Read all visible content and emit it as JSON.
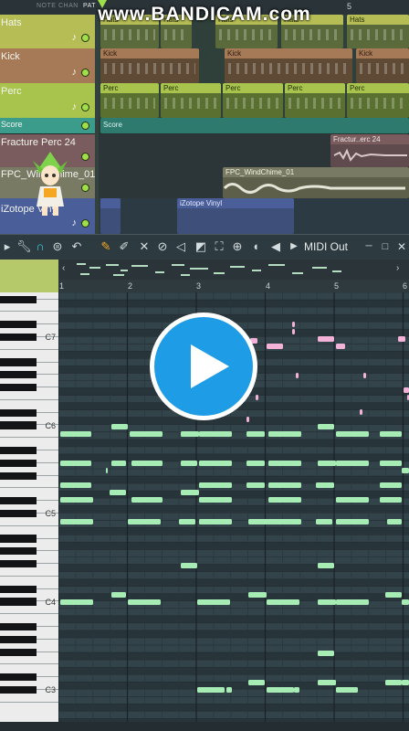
{
  "watermark": "www.BANDICAM.com",
  "header": {
    "labels": [
      "NOTE",
      "CHAN",
      "PAT"
    ],
    "bar_5": "5"
  },
  "tracks": [
    {
      "name": "Hats",
      "color": "#b5bd54"
    },
    {
      "name": "Kick",
      "color": "#a67a57"
    },
    {
      "name": "Perc",
      "color": "#a8c44c"
    },
    {
      "name": "Score",
      "color": "#3c9c8c"
    },
    {
      "name": "Fracture Perc 24",
      "color": "#7a5c5f"
    },
    {
      "name": "FPC_WindChime_01",
      "color": "#787a63"
    },
    {
      "name": "iZotope Vinyl",
      "color": "#4a5f9a"
    }
  ],
  "clips": {
    "hats": "Hats",
    "kick": "Kick",
    "perc": "Perc",
    "score": "Score",
    "fracture": "Fractur..erc 24",
    "windchime": "FPC_WindChime_01",
    "vinyl": "iZotope Vinyl"
  },
  "toolbar": {
    "midi_out": "MIDI Out",
    "icons": [
      "play-arrow-icon",
      "wrench-icon",
      "magnet-icon",
      "menu-icon",
      "undo-icon",
      "pencil-icon",
      "brush-icon",
      "delete-icon",
      "mute-icon",
      "slice-icon",
      "select-icon",
      "zoom-icon",
      "playback-icon"
    ]
  },
  "ruler": [
    "1",
    "2",
    "3",
    "4",
    "5",
    "6"
  ],
  "keyboard": {
    "labels": [
      "C7",
      "C6",
      "C5",
      "C4",
      "C3"
    ]
  },
  "overlay": {
    "icon": "play-circle-icon"
  },
  "notes": {
    "main_color": "#a6ecb4",
    "accent_color": "#f3b2d8"
  }
}
